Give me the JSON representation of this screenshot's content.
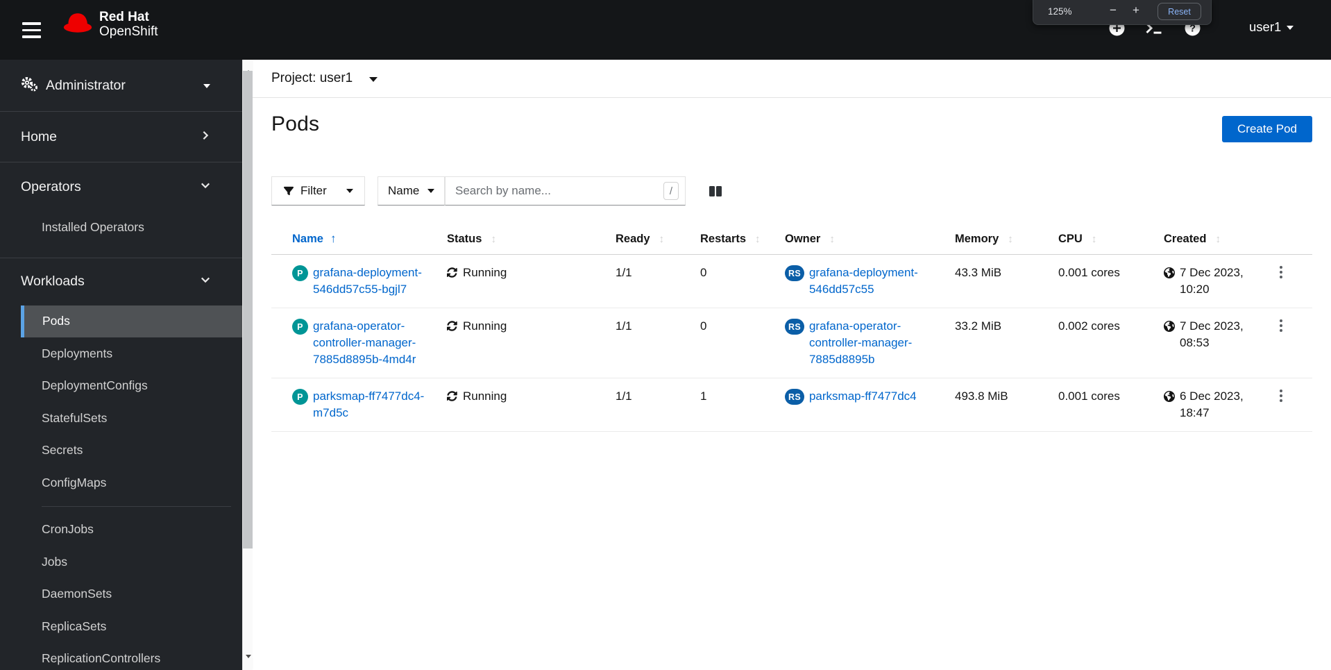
{
  "masthead": {
    "brand": {
      "line1": "Red Hat",
      "line2": "OpenShift"
    },
    "username": "user1",
    "zoom_popup": {
      "level": "125%",
      "minus": "−",
      "plus": "+",
      "reset": "Reset"
    }
  },
  "sidebar": {
    "perspective": {
      "label": "Administrator"
    },
    "sections": [
      {
        "label": "Home",
        "state": "collapsed",
        "items": []
      },
      {
        "label": "Operators",
        "state": "expanded",
        "items": [
          {
            "label": "Installed Operators",
            "selected": false
          }
        ]
      },
      {
        "label": "Workloads",
        "state": "expanded",
        "items": [
          {
            "label": "Pods",
            "selected": true
          },
          {
            "label": "Deployments",
            "selected": false
          },
          {
            "label": "DeploymentConfigs",
            "selected": false
          },
          {
            "label": "StatefulSets",
            "selected": false
          },
          {
            "label": "Secrets",
            "selected": false
          },
          {
            "label": "ConfigMaps",
            "selected": false
          },
          {
            "label": "CronJobs",
            "selected": false
          },
          {
            "label": "Jobs",
            "selected": false
          },
          {
            "label": "DaemonSets",
            "selected": false
          },
          {
            "label": "ReplicaSets",
            "selected": false
          },
          {
            "label": "ReplicationControllers",
            "selected": false
          }
        ]
      }
    ]
  },
  "main": {
    "project_selector": {
      "label": "Project: user1"
    },
    "page": {
      "title": "Pods",
      "create_button": "Create Pod"
    },
    "toolbar": {
      "filter_label": "Filter",
      "search_type": "Name",
      "search_placeholder": "Search by name...",
      "search_shortcut": "/"
    },
    "table": {
      "headers": [
        "Name",
        "Status",
        "Ready",
        "Restarts",
        "Owner",
        "Memory",
        "CPU",
        "Created"
      ],
      "sorted_by": "Name",
      "sort_direction": "ascending",
      "rows": [
        {
          "badge": "P",
          "name": "grafana-deployment-546dd57c55-bgjl7",
          "status": "Running",
          "ready": "1/1",
          "restarts": "0",
          "owner_badge": "RS",
          "owner": "grafana-deployment-546dd57c55",
          "memory": "43.3 MiB",
          "cpu": "0.001 cores",
          "created": "7 Dec 2023, 10:20"
        },
        {
          "badge": "P",
          "name": "grafana-operator-controller-manager-7885d8895b-4md4r",
          "status": "Running",
          "ready": "1/1",
          "restarts": "0",
          "owner_badge": "RS",
          "owner": "grafana-operator-controller-manager-7885d8895b",
          "memory": "33.2 MiB",
          "cpu": "0.002 cores",
          "created": "7 Dec 2023, 08:53"
        },
        {
          "badge": "P",
          "name": "parksmap-ff7477dc4-m7d5c",
          "status": "Running",
          "ready": "1/1",
          "restarts": "1",
          "owner_badge": "RS",
          "owner": "parksmap-ff7477dc4",
          "memory": "493.8 MiB",
          "cpu": "0.001 cores",
          "created": "6 Dec 2023, 18:47"
        }
      ]
    }
  },
  "colors": {
    "link": "#0066cc",
    "primary_button": "#0066cc",
    "pod_badge": "#009596",
    "replicaset_badge": "#0b5ea7",
    "nav_selected_indicator": "#5ba3e6",
    "masthead_bg": "#141618",
    "sidebar_bg": "#222529"
  },
  "icons": {
    "hamburger-menu-icon": "three bars",
    "redhat-logo-icon": "red fedora hat",
    "gears-icon": "cogs",
    "chevron-right-icon": "❯",
    "chevron-down-icon": "⌄",
    "caret-down-icon": "▾",
    "plus-circle-icon": "white circle with plus",
    "terminal-icon": ">_",
    "help-icon": "white circle with ?",
    "filter-funnel-icon": "funnel",
    "column-management-icon": "two columns",
    "sort-ascending-icon": "↑",
    "sort-both-icon": "↕",
    "running-sync-icon": "circular arrows",
    "timestamp-globe-icon": "globe",
    "kebab-icon": "⋮",
    "scrollbar-up-icon": "▲",
    "scrollbar-down-icon": "▼"
  }
}
